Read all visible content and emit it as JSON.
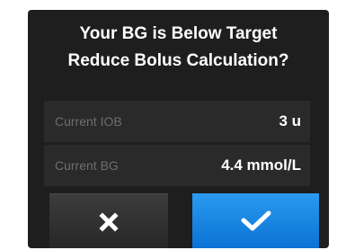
{
  "dialog": {
    "title_line1": "Your BG is Below Target",
    "title_line2": "Reduce Bolus Calculation?"
  },
  "rows": [
    {
      "label": "Current IOB",
      "value": "3 u"
    },
    {
      "label": "Current BG",
      "value": "4.4 mmol/L"
    }
  ],
  "buttons": {
    "cancel_icon": "close-x-icon",
    "confirm_icon": "checkmark-icon",
    "confirm_color": "#1a8ae6"
  }
}
